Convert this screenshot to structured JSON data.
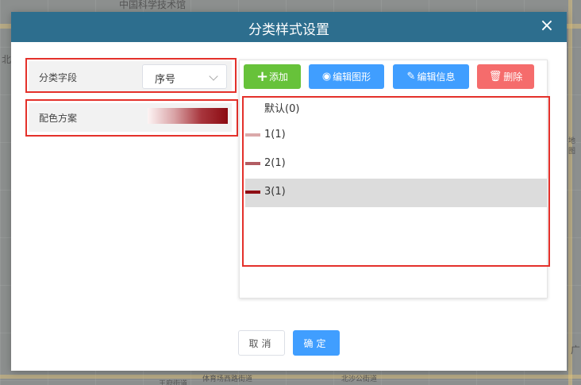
{
  "map": {
    "labels": [
      "中国科学技术馆",
      "北",
      "体育场西路街道",
      "王府街道",
      "北沙公街道",
      "广",
      "地图"
    ]
  },
  "dialog": {
    "title": "分类样式设置",
    "close_glyph": "×"
  },
  "left_panel": {
    "field_label": "分类字段",
    "field_value": "序号",
    "color_label": "配色方案",
    "gradient": [
      "#fdf4f4",
      "#d9a3a6",
      "#a8363d",
      "#8c0b12"
    ]
  },
  "toolbar": {
    "add_label": "添加",
    "edit_shape_label": "编辑图形",
    "edit_info_label": "编辑信息",
    "delete_label": "删除"
  },
  "list": {
    "items": [
      {
        "label": "默认(0)",
        "color": ""
      },
      {
        "label": "1(1)",
        "color": "#dba9aa"
      },
      {
        "label": "2(1)",
        "color": "#b25d63"
      },
      {
        "label": "3(1)",
        "color": "#8e0d14"
      }
    ],
    "selected_index": 3
  },
  "footer": {
    "cancel_label": "取消",
    "ok_label": "确定"
  },
  "colors": {
    "header": "#2d6e8e",
    "add": "#67c23a",
    "primary": "#409eff",
    "danger": "#f56c6c",
    "highlight": "#e4312b"
  }
}
